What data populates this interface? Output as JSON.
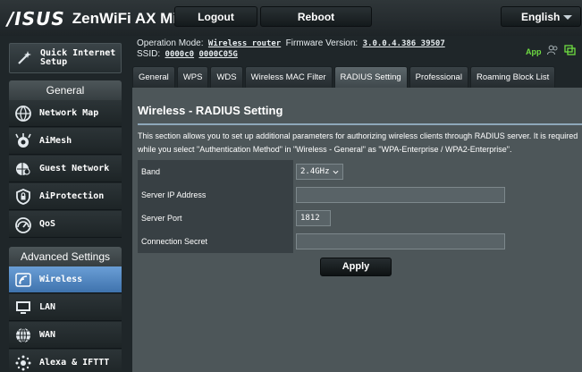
{
  "header": {
    "logo_text": "/ISUS",
    "model": "ZenWiFi AX Mini",
    "logout_label": "Logout",
    "reboot_label": "Reboot",
    "language": "English"
  },
  "sidebar": {
    "quick_setup": "Quick Internet\nSetup",
    "general_header": "General",
    "general_items": [
      {
        "label": "Network Map",
        "icon": "network-map-icon"
      },
      {
        "label": "AiMesh",
        "icon": "aimesh-icon"
      },
      {
        "label": "Guest Network",
        "icon": "guest-network-icon"
      },
      {
        "label": "AiProtection",
        "icon": "shield-icon"
      },
      {
        "label": "QoS",
        "icon": "qos-gauge-icon"
      }
    ],
    "advanced_header": "Advanced Settings",
    "advanced_items": [
      {
        "label": "Wireless",
        "icon": "wireless-icon",
        "active": true
      },
      {
        "label": "LAN",
        "icon": "lan-icon"
      },
      {
        "label": "WAN",
        "icon": "wan-globe-icon"
      },
      {
        "label": "Alexa & IFTTT",
        "icon": "alexa-icon"
      }
    ]
  },
  "info": {
    "op_mode_label": "Operation Mode:",
    "op_mode_value": "Wireless router",
    "firmware_label": "Firmware Version:",
    "firmware_value": "3.0.0.4.386_39507",
    "ssid_label": "SSID:",
    "ssid_1": "0000c0",
    "ssid_2": "0000C05G",
    "app_label": "App"
  },
  "tabs": [
    {
      "label": "General"
    },
    {
      "label": "WPS"
    },
    {
      "label": "WDS"
    },
    {
      "label": "Wireless MAC Filter"
    },
    {
      "label": "RADIUS Setting",
      "active": true
    },
    {
      "label": "Professional"
    },
    {
      "label": "Roaming Block List"
    }
  ],
  "main": {
    "title": "Wireless - RADIUS Setting",
    "description": "This section allows you to set up additional parameters for authorizing wireless clients through RADIUS server. It is required while you select \"Authentication Method\" in \"Wireless - General\" as \"WPA-Enterprise / WPA2-Enterprise\".",
    "rows": {
      "band_label": "Band",
      "band_value": "2.4GHz",
      "server_ip_label": "Server IP Address",
      "server_ip_value": "",
      "server_port_label": "Server Port",
      "server_port_value": "1812",
      "secret_label": "Connection Secret",
      "secret_value": ""
    },
    "apply_label": "Apply"
  },
  "colors": {
    "accent_active": "#4f86c4",
    "app_green": "#6fdc42"
  }
}
